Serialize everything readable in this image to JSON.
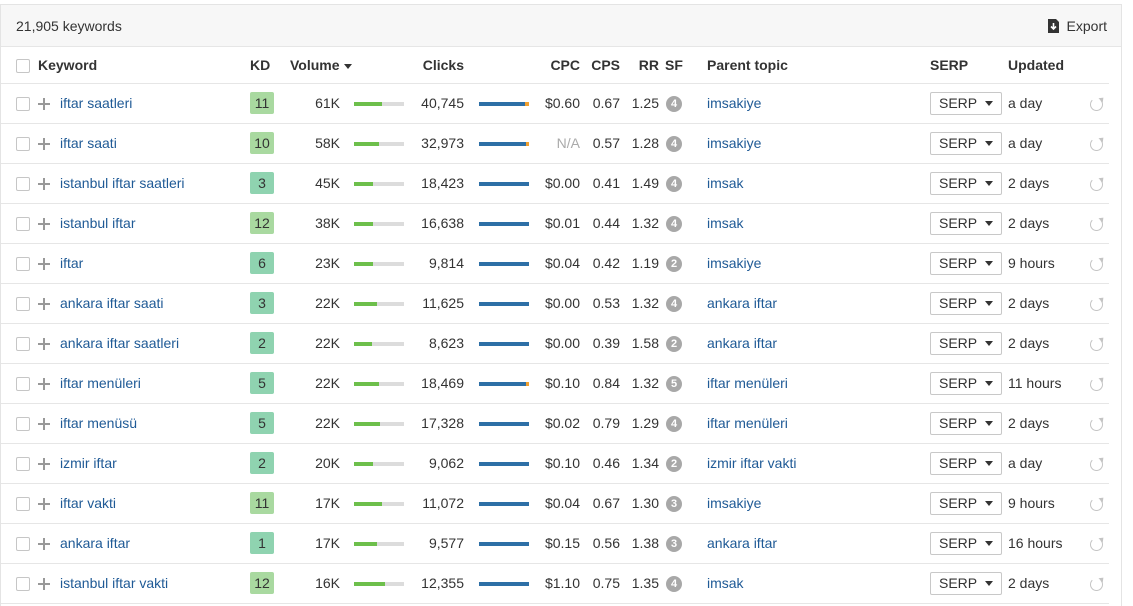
{
  "header": {
    "keyword_count": "21,905 keywords",
    "export_label": "Export"
  },
  "columns": {
    "keyword": "Keyword",
    "kd": "KD",
    "volume": "Volume",
    "clicks": "Clicks",
    "cpc": "CPC",
    "cps": "CPS",
    "rr": "RR",
    "sf": "SF",
    "parent_topic": "Parent topic",
    "serp": "SERP",
    "updated": "Updated"
  },
  "serp_button_label": "SERP",
  "colors": {
    "link": "#1f5a96",
    "volume_bar": "#6dbf4b",
    "clicks_bar": "#2d6fa6",
    "paid_clicks": "#f0a030"
  },
  "rows": [
    {
      "keyword": "iftar saatleri",
      "kd": "11",
      "kd_color": "#a9d9a0",
      "volume": "61K",
      "volume_level": 0.55,
      "clicks": "40,745",
      "paid_share": 0.08,
      "cpc": "$0.60",
      "cps": "0.67",
      "rr": "1.25",
      "sf": "4",
      "parent_topic": "imsakiye",
      "updated": "a day"
    },
    {
      "keyword": "iftar saati",
      "kd": "10",
      "kd_color": "#a9d9a0",
      "volume": "58K",
      "volume_level": 0.5,
      "clicks": "32,973",
      "paid_share": 0.06,
      "cpc": "N/A",
      "cps": "0.57",
      "rr": "1.28",
      "sf": "4",
      "parent_topic": "imsakiye",
      "updated": "a day"
    },
    {
      "keyword": "istanbul iftar saatleri",
      "kd": "3",
      "kd_color": "#8fd3b0",
      "volume": "45K",
      "volume_level": 0.38,
      "clicks": "18,423",
      "paid_share": 0.0,
      "cpc": "$0.00",
      "cps": "0.41",
      "rr": "1.49",
      "sf": "4",
      "parent_topic": "imsak",
      "updated": "2 days"
    },
    {
      "keyword": "istanbul iftar",
      "kd": "12",
      "kd_color": "#a9d9a0",
      "volume": "38K",
      "volume_level": 0.38,
      "clicks": "16,638",
      "paid_share": 0.0,
      "cpc": "$0.01",
      "cps": "0.44",
      "rr": "1.32",
      "sf": "4",
      "parent_topic": "imsak",
      "updated": "2 days"
    },
    {
      "keyword": "iftar",
      "kd": "6",
      "kd_color": "#8fd3b0",
      "volume": "23K",
      "volume_level": 0.38,
      "clicks": "9,814",
      "paid_share": 0.0,
      "cpc": "$0.04",
      "cps": "0.42",
      "rr": "1.19",
      "sf": "2",
      "parent_topic": "imsakiye",
      "updated": "9 hours"
    },
    {
      "keyword": "ankara iftar saati",
      "kd": "3",
      "kd_color": "#8fd3b0",
      "volume": "22K",
      "volume_level": 0.45,
      "clicks": "11,625",
      "paid_share": 0.0,
      "cpc": "$0.00",
      "cps": "0.53",
      "rr": "1.32",
      "sf": "4",
      "parent_topic": "ankara iftar",
      "updated": "2 days"
    },
    {
      "keyword": "ankara iftar saatleri",
      "kd": "2",
      "kd_color": "#8fd3b0",
      "volume": "22K",
      "volume_level": 0.35,
      "clicks": "8,623",
      "paid_share": 0.0,
      "cpc": "$0.00",
      "cps": "0.39",
      "rr": "1.58",
      "sf": "2",
      "parent_topic": "ankara iftar",
      "updated": "2 days"
    },
    {
      "keyword": "iftar menüleri",
      "kd": "5",
      "kd_color": "#8fd3b0",
      "volume": "22K",
      "volume_level": 0.5,
      "clicks": "18,469",
      "paid_share": 0.06,
      "cpc": "$0.10",
      "cps": "0.84",
      "rr": "1.32",
      "sf": "5",
      "parent_topic": "iftar menüleri",
      "updated": "11 hours"
    },
    {
      "keyword": "iftar menüsü",
      "kd": "5",
      "kd_color": "#8fd3b0",
      "volume": "22K",
      "volume_level": 0.52,
      "clicks": "17,328",
      "paid_share": 0.0,
      "cpc": "$0.02",
      "cps": "0.79",
      "rr": "1.29",
      "sf": "4",
      "parent_topic": "iftar menüleri",
      "updated": "2 days"
    },
    {
      "keyword": "izmir iftar",
      "kd": "2",
      "kd_color": "#8fd3b0",
      "volume": "20K",
      "volume_level": 0.38,
      "clicks": "9,062",
      "paid_share": 0.0,
      "cpc": "$0.10",
      "cps": "0.46",
      "rr": "1.34",
      "sf": "2",
      "parent_topic": "izmir iftar vakti",
      "updated": "a day"
    },
    {
      "keyword": "iftar vakti",
      "kd": "11",
      "kd_color": "#a9d9a0",
      "volume": "17K",
      "volume_level": 0.55,
      "clicks": "11,072",
      "paid_share": 0.0,
      "cpc": "$0.04",
      "cps": "0.67",
      "rr": "1.30",
      "sf": "3",
      "parent_topic": "imsakiye",
      "updated": "9 hours"
    },
    {
      "keyword": "ankara iftar",
      "kd": "1",
      "kd_color": "#8fd3b0",
      "volume": "17K",
      "volume_level": 0.45,
      "clicks": "9,577",
      "paid_share": 0.0,
      "cpc": "$0.15",
      "cps": "0.56",
      "rr": "1.38",
      "sf": "3",
      "parent_topic": "ankara iftar",
      "updated": "16 hours"
    },
    {
      "keyword": "istanbul iftar vakti",
      "kd": "12",
      "kd_color": "#a9d9a0",
      "volume": "16K",
      "volume_level": 0.62,
      "clicks": "12,355",
      "paid_share": 0.0,
      "cpc": "$1.10",
      "cps": "0.75",
      "rr": "1.35",
      "sf": "4",
      "parent_topic": "imsak",
      "updated": "2 days"
    }
  ]
}
